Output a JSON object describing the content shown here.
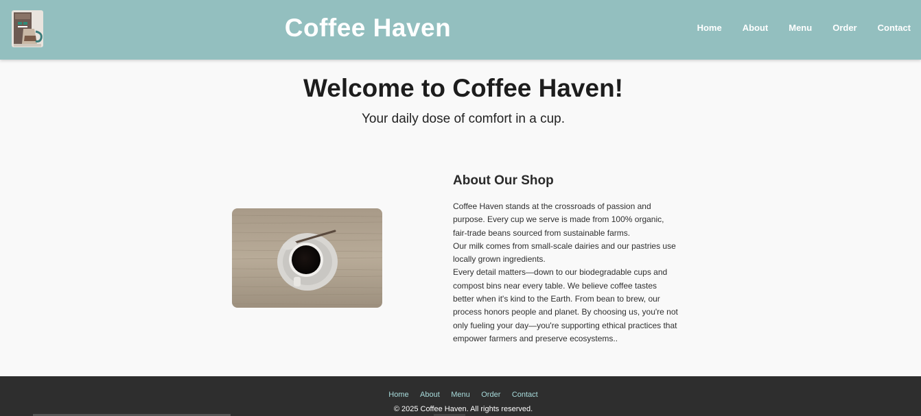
{
  "header": {
    "title": "Coffee Haven",
    "nav": [
      "Home",
      "About",
      "Menu",
      "Order",
      "Contact"
    ]
  },
  "hero": {
    "title": "Welcome to Coffee Haven!",
    "subtitle": "Your daily dose of comfort in a cup."
  },
  "about": {
    "heading": "About Our Shop",
    "paragraphs": [
      "Coffee Haven stands at the crossroads of passion and purpose. Every cup we serve is made from 100% organic, fair-trade beans sourced from sustainable farms.",
      "Our milk comes from small-scale dairies and our pastries use locally grown ingredients.",
      "Every detail matters—down to our biodegradable cups and compost bins near every table. We believe coffee tastes better when it's kind to the Earth. From bean to brew, our process honors people and planet. By choosing us, you're not only fueling your day—you're supporting ethical practices that empower farmers and preserve ecosystems.."
    ]
  },
  "footer": {
    "nav": [
      "Home",
      "About",
      "Menu",
      "Order",
      "Contact"
    ],
    "copyright": "© 2025 Coffee Haven. All rights reserved."
  },
  "colors": {
    "header_bg": "#93bfbf",
    "footer_bg": "#2e2e2e",
    "footer_link": "#a8dcdc"
  },
  "icons": {
    "logo": "coffee-maker-icon"
  }
}
